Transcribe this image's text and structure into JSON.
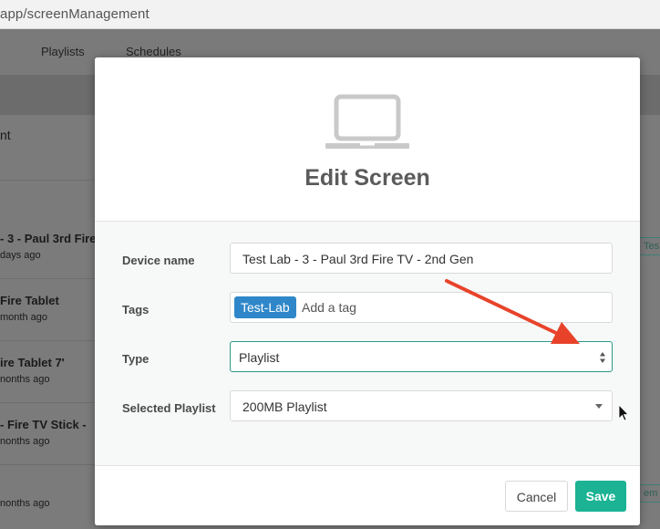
{
  "browser": {
    "url": "app/screenManagement"
  },
  "nav": {
    "items": [
      "Playlists",
      "Schedules"
    ]
  },
  "background_list": {
    "header_fragment": "nt",
    "rows": [
      {
        "title": "- 3 - Paul 3rd Fire",
        "sub": "days ago"
      },
      {
        "title": "Fire Tablet",
        "sub": "month ago"
      },
      {
        "title": "ire Tablet 7'",
        "sub": "nonths ago"
      },
      {
        "title": "- Fire TV Stick -",
        "sub": "nonths ago"
      },
      {
        "title": "",
        "sub": "nonths ago"
      }
    ],
    "side_tags": [
      "Tes",
      "em"
    ]
  },
  "modal": {
    "title": "Edit Screen",
    "icon": "laptop-icon",
    "fields": {
      "device_name": {
        "label": "Device name",
        "value": "Test Lab - 3 - Paul 3rd Fire TV - 2nd Gen"
      },
      "tags": {
        "label": "Tags",
        "chip": "Test-Lab",
        "placeholder": "Add a tag"
      },
      "type": {
        "label": "Type",
        "value": "Playlist"
      },
      "playlist": {
        "label": "Selected Playlist",
        "value": "200MB Playlist"
      }
    },
    "buttons": {
      "cancel": "Cancel",
      "save": "Save"
    }
  },
  "colors": {
    "primary": "#1bb394",
    "tag": "#2f87c9",
    "arrow": "#e8432a",
    "focus": "#2a9a86"
  }
}
